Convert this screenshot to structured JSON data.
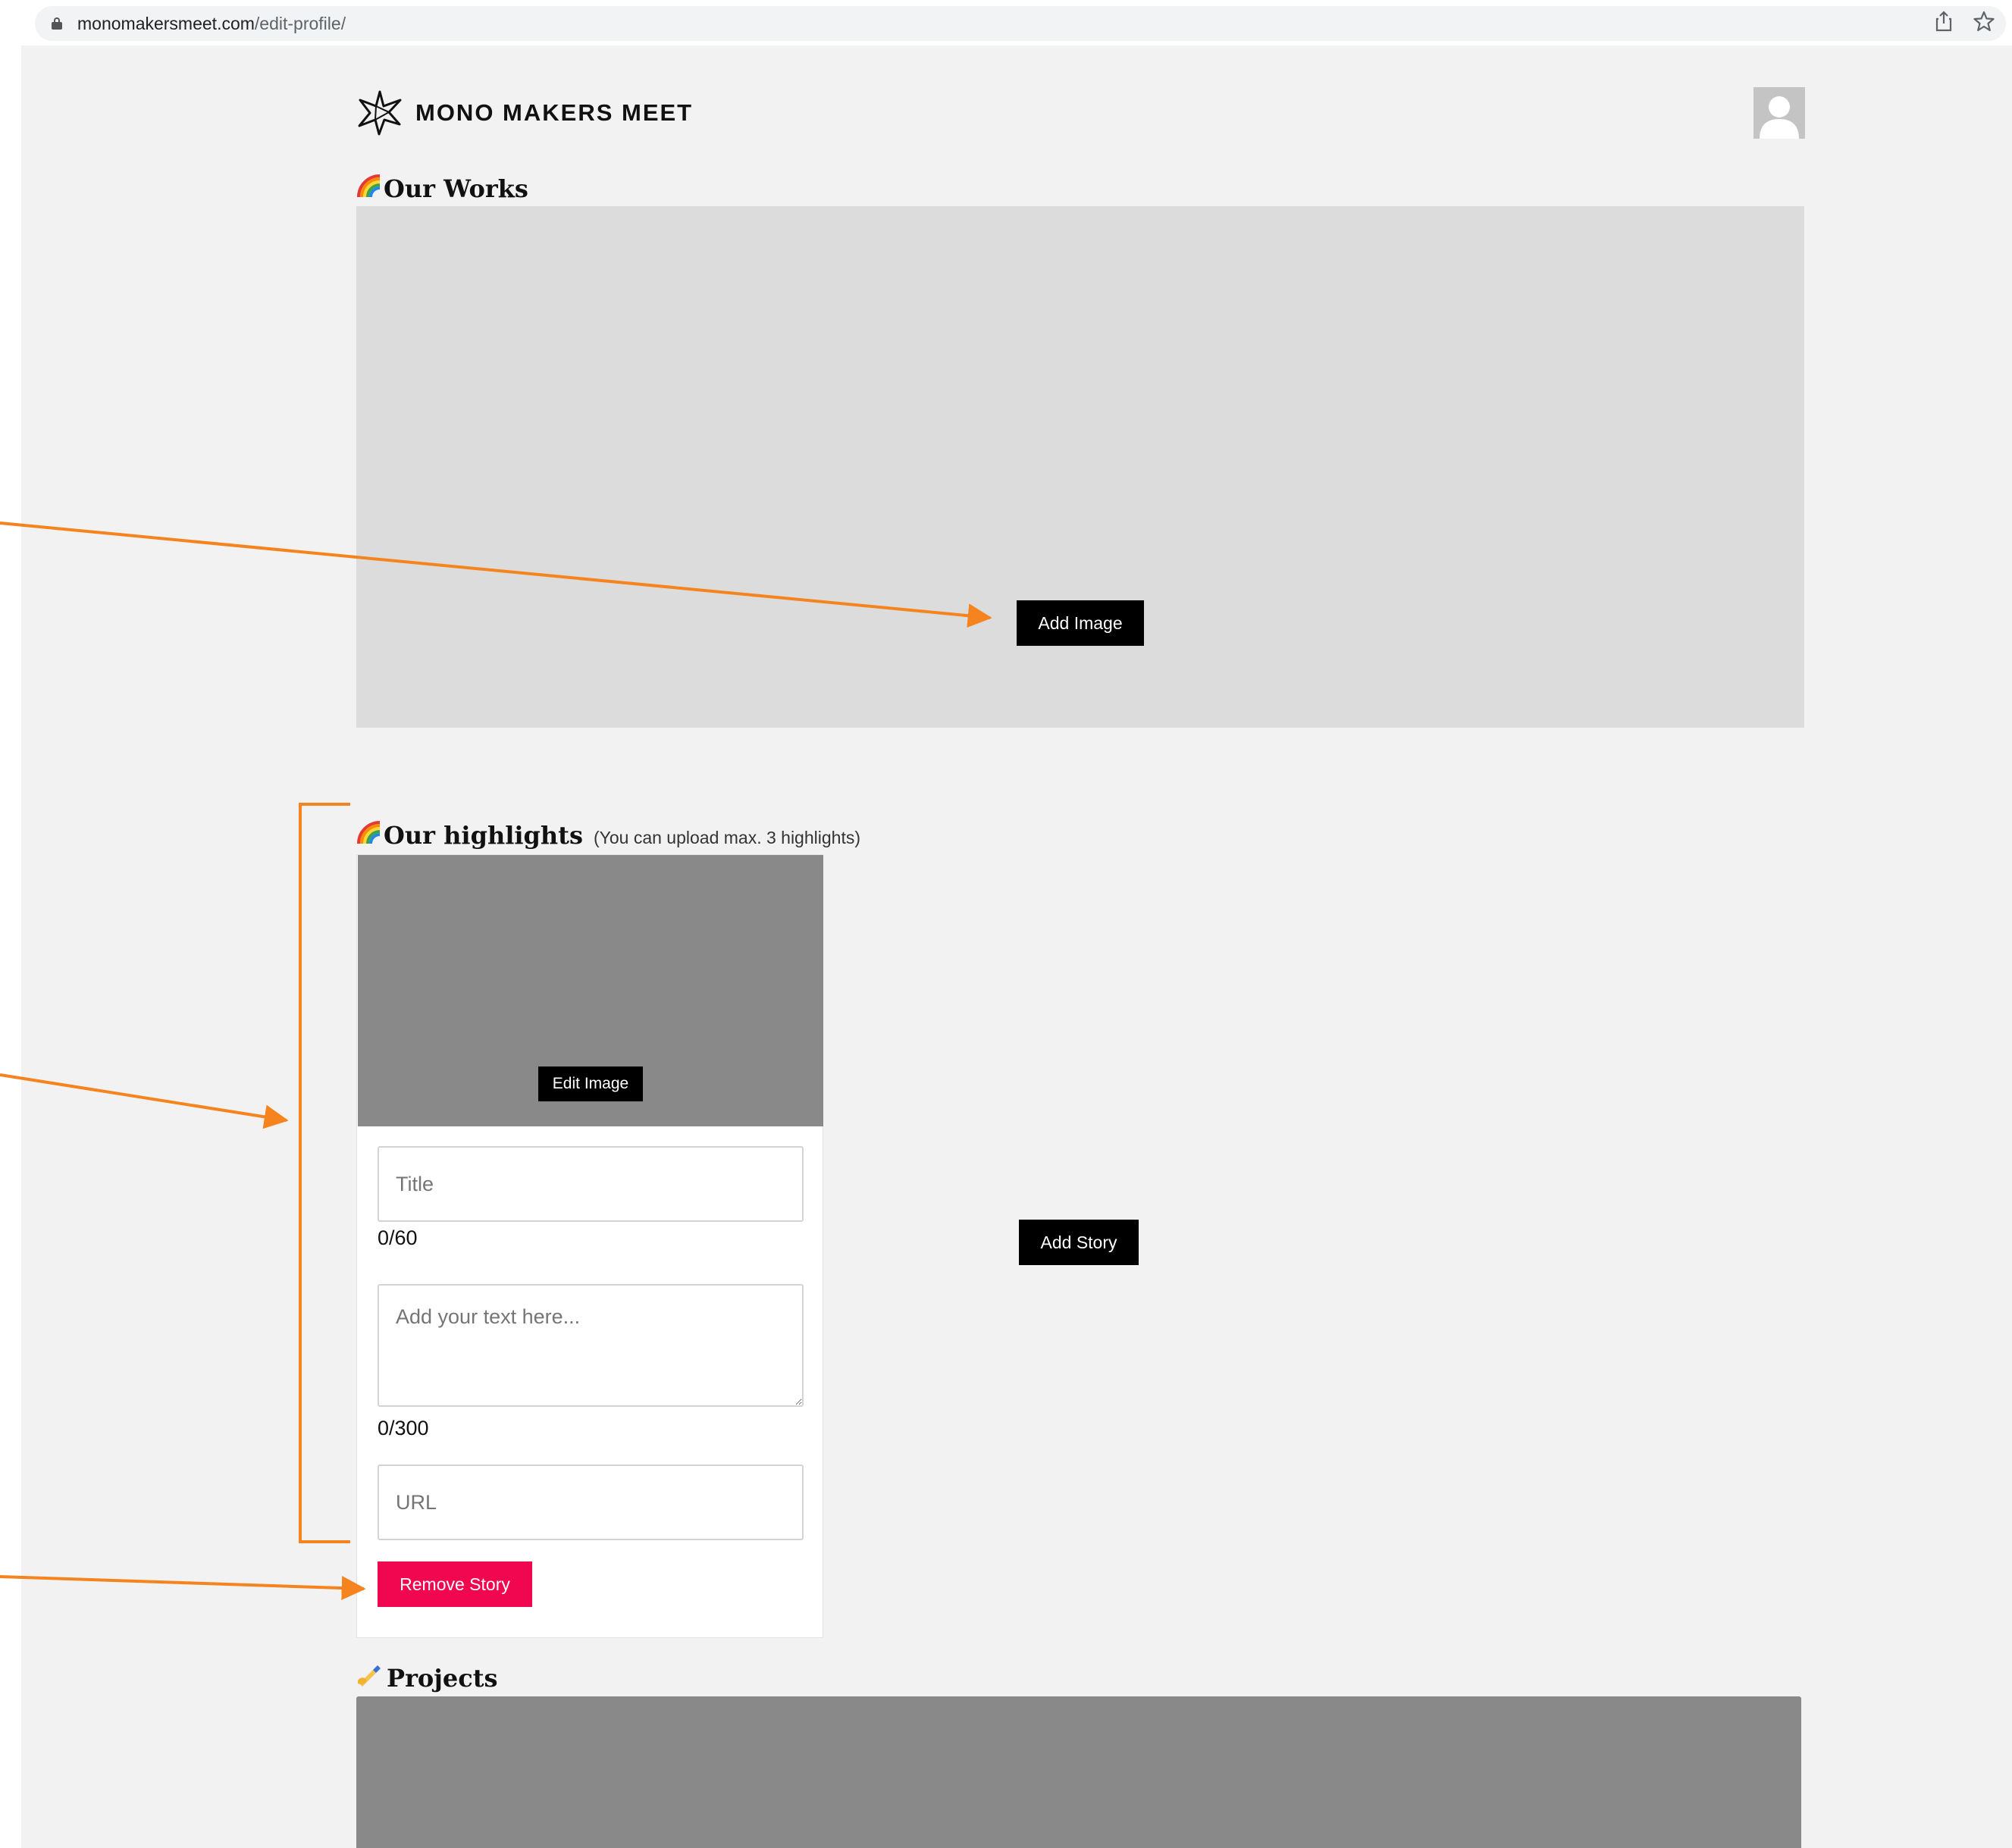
{
  "browser": {
    "url_domain": "monomakersmeet.com",
    "url_path": "/edit-profile/",
    "share_icon": "share-icon",
    "bookmark_icon": "star-icon"
  },
  "header": {
    "logo_text": "MONO MAKERS MEET",
    "logo_icon": "star-logo-icon",
    "avatar_icon": "user-avatar-icon"
  },
  "works": {
    "title": "Our Works",
    "title_icon": "rainbow-icon",
    "add_image_label": "Add Image"
  },
  "highlights": {
    "title": "Our highlights",
    "title_icon": "rainbow-icon",
    "hint": "(You can upload max. 3 highlights)",
    "add_story_label": "Add Story",
    "story": {
      "edit_image_label": "Edit Image",
      "title_placeholder": "Title",
      "title_counter": "0/60",
      "text_placeholder": "Add your text here...",
      "text_counter": "0/300",
      "url_placeholder": "URL",
      "remove_label": "Remove Story"
    }
  },
  "projects": {
    "title": "Projects",
    "title_icon": "writing-hand-icon"
  },
  "colors": {
    "page_bg": "#f2f2f2",
    "works_bg": "#dcdcdc",
    "image_placeholder": "#898989",
    "button_dark": "#000000",
    "remove_button": "#f0074f",
    "annotation": "#f5841f"
  }
}
